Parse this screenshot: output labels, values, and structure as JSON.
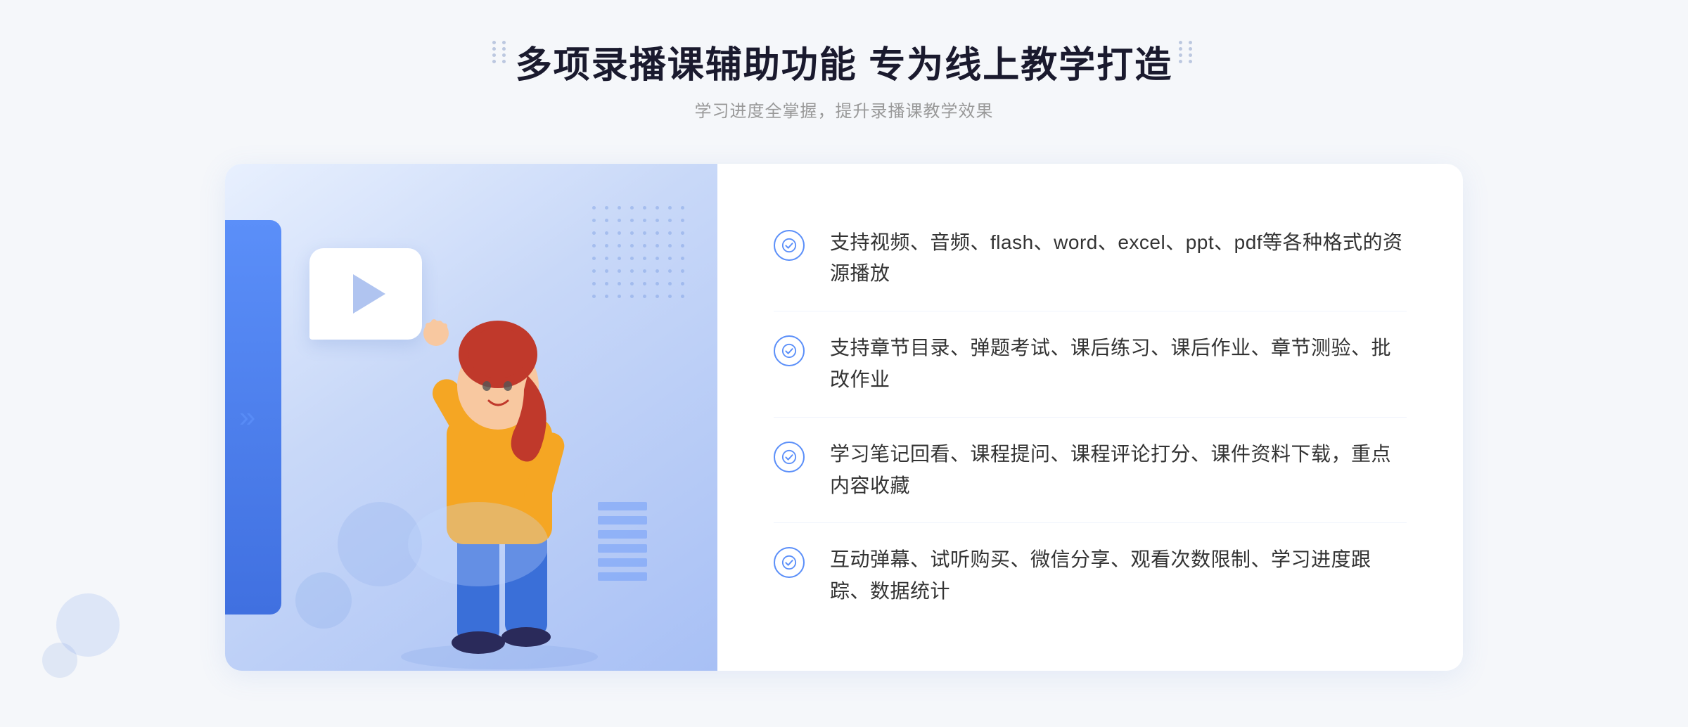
{
  "header": {
    "main_title": "多项录播课辅助功能 专为线上教学打造",
    "sub_title": "学习进度全掌握，提升录播课教学效果"
  },
  "features": [
    {
      "id": "feature-1",
      "text": "支持视频、音频、flash、word、excel、ppt、pdf等各种格式的资源播放"
    },
    {
      "id": "feature-2",
      "text": "支持章节目录、弹题考试、课后练习、课后作业、章节测验、批改作业"
    },
    {
      "id": "feature-3",
      "text": "学习笔记回看、课程提问、课程评论打分、课件资料下载，重点内容收藏"
    },
    {
      "id": "feature-4",
      "text": "互动弹幕、试听购买、微信分享、观看次数限制、学习进度跟踪、数据统计"
    }
  ],
  "colors": {
    "primary": "#5b8ff9",
    "title": "#1a1a2e",
    "subtitle": "#999999",
    "text": "#333333",
    "border": "#f0f4fc"
  }
}
